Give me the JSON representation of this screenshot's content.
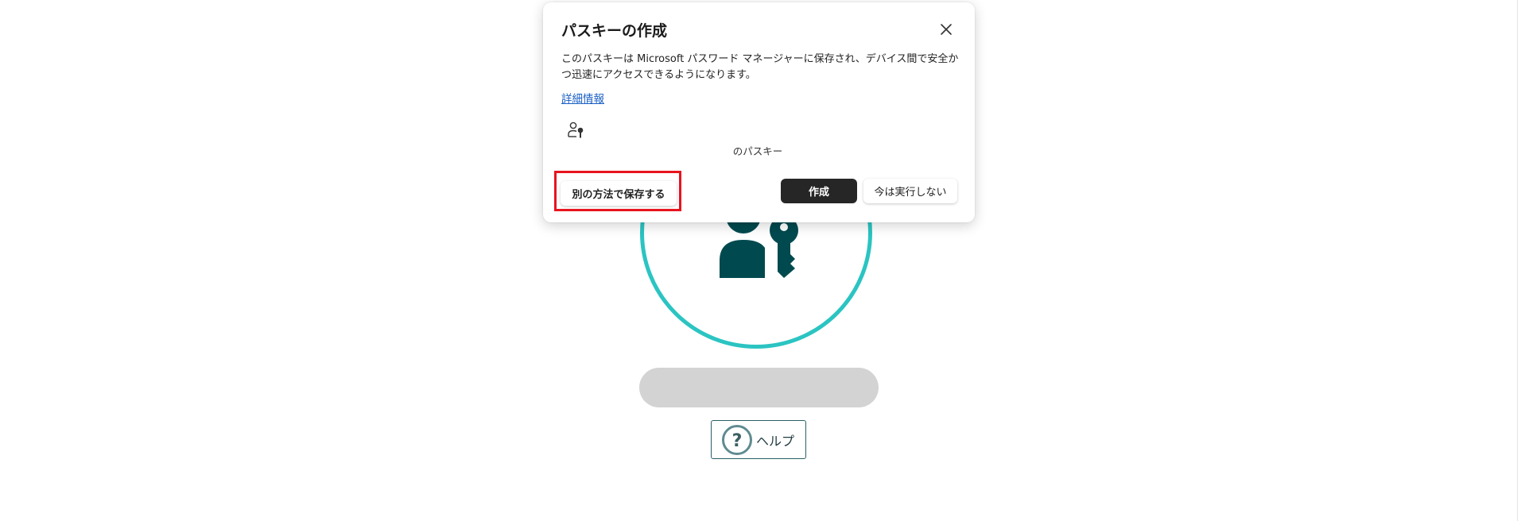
{
  "dialog": {
    "title": "パスキーの作成",
    "description": "このパスキーは Microsoft パスワード マネージャーに保存され、デバイス間で安全かつ迅速にアクセスできるようになります。",
    "learn_more": "詳細情報",
    "account_label": "のパスキー",
    "save_another_way": "別の方法で保存する",
    "create": "作成",
    "not_now": "今は実行しない",
    "close_icon": "close-icon",
    "account_icon": "person-key-icon"
  },
  "page": {
    "help_label": "ヘルプ",
    "hero_icon": "person-key-icon",
    "help_icon": "question-circle-icon"
  },
  "colors": {
    "ring": "#2bc4c2",
    "icon_dark": "#004a4f",
    "highlight": "#e8141e",
    "primary_button": "#262626",
    "link": "#1a5fc4"
  }
}
